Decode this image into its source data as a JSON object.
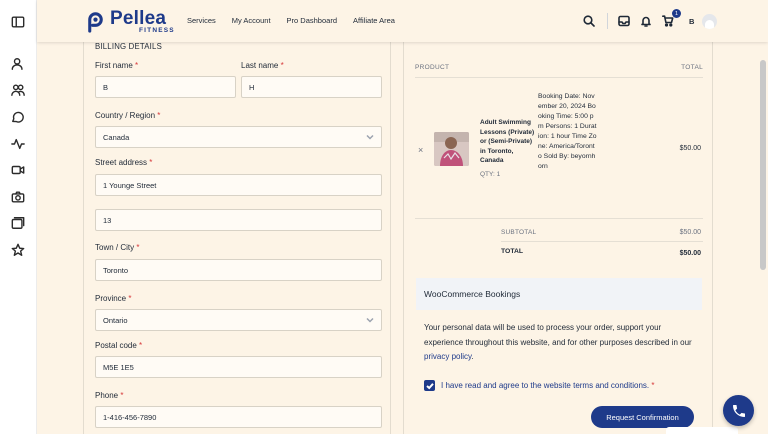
{
  "header": {
    "logo_name": "Pellea",
    "logo_sub": "FITNESS",
    "nav": [
      "Services",
      "My Account",
      "Pro Dashboard",
      "Affiliate Area"
    ],
    "cart_count": "1",
    "user_initial": "B"
  },
  "rail": {
    "icons": [
      "sidebar-toggle-icon",
      "user-plus-icon",
      "users-icon",
      "chat-icon",
      "activity-icon",
      "video-icon",
      "camera-icon",
      "gallery-icon",
      "star-icon"
    ]
  },
  "billing": {
    "title": "BILLING DETAILS",
    "first_name": {
      "label": "First name",
      "value": "B"
    },
    "last_name": {
      "label": "Last name",
      "value": "H"
    },
    "country": {
      "label": "Country / Region",
      "value": "Canada"
    },
    "street": {
      "label": "Street address",
      "line1": "1 Younge Street",
      "line2": "13"
    },
    "city": {
      "label": "Town / City",
      "value": "Toronto"
    },
    "province": {
      "label": "Province",
      "value": "Ontario"
    },
    "postal": {
      "label": "Postal code",
      "value": "M5E 1E5"
    },
    "phone": {
      "label": "Phone",
      "value": "1-416-456-7890"
    },
    "required_mark": "*"
  },
  "order": {
    "col_product": "PRODUCT",
    "col_total": "TOTAL",
    "remove": "×",
    "product_name": "Adult Swimming Lessons (Private) or (Semi-Private) in Toronto, Canada",
    "qty": "QTY: 1",
    "meta": "Booking Date: November 20, 2024 Booking Time: 5:00 pm Persons: 1 Duration: 1 hour Time Zone: America/Toronto Sold By: beyornhorn",
    "price": "$50.00",
    "subtotal_label": "SUBTOTAL",
    "subtotal_value": "$50.00",
    "total_label": "TOTAL",
    "total_value": "$50.00",
    "booking_heading": "WooCommerce Bookings",
    "privacy_text": "Your personal data will be used to process your order, support your experience throughout this website, and for other purposes described in our ",
    "privacy_link": "privacy policy",
    "privacy_end": ".",
    "terms_text": "I have read and agree to the website terms and conditions.",
    "terms_req": "*",
    "submit_label": "Request Confirmation"
  },
  "colors": {
    "brand": "#1e3a8a",
    "background": "#fdf4e6",
    "required": "#d63638"
  }
}
